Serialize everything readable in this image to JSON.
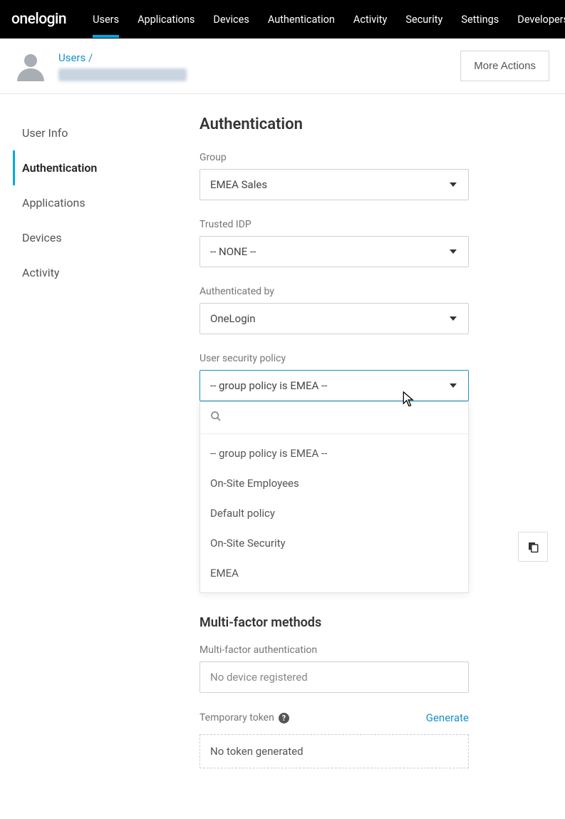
{
  "brand": "onelogin",
  "topnav": [
    "Users",
    "Applications",
    "Devices",
    "Authentication",
    "Activity",
    "Security",
    "Settings",
    "Developers"
  ],
  "topnav_active_index": 0,
  "breadcrumb": {
    "parent": "Users /"
  },
  "more_actions_label": "More Actions",
  "sidebar": {
    "items": [
      "User Info",
      "Authentication",
      "Applications",
      "Devices",
      "Activity"
    ],
    "active_index": 1
  },
  "page_title": "Authentication",
  "fields": {
    "group": {
      "label": "Group",
      "value": "EMEA Sales"
    },
    "trusted_idp": {
      "label": "Trusted IDP",
      "value": "-- NONE --"
    },
    "authenticated_by": {
      "label": "Authenticated by",
      "value": "OneLogin"
    },
    "user_security_policy": {
      "label": "User security policy",
      "value": "-- group policy is EMEA --",
      "options": [
        "-- group policy is EMEA --",
        "On-Site Employees",
        "Default policy",
        "On-Site Security",
        "EMEA"
      ]
    }
  },
  "mfa": {
    "title": "Multi-factor methods",
    "label": "Multi-factor authentication",
    "value": "No device registered"
  },
  "token": {
    "label": "Temporary token",
    "generate": "Generate",
    "status": "No token generated"
  }
}
